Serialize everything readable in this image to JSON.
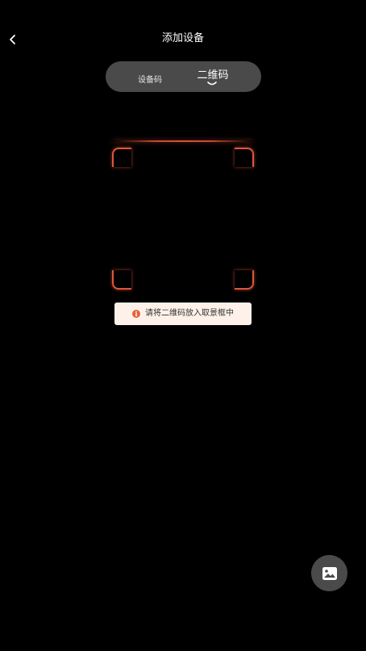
{
  "header": {
    "title": "添加设备",
    "back_icon": "chevron-left-icon"
  },
  "tabs": [
    {
      "label": "设备码",
      "active": false
    },
    {
      "label": "二维码",
      "active": true
    }
  ],
  "scanner": {
    "accent_color": "#e0553c",
    "hint_icon": "info-icon",
    "hint_icon_glyph": "i",
    "hint_text": "请将二维码放入取景框中"
  },
  "gallery_button": {
    "icon": "image-icon"
  },
  "colors": {
    "background": "#000000",
    "tab_bar": "#4a4a4a",
    "hint_bg": "#fdf1ea"
  }
}
